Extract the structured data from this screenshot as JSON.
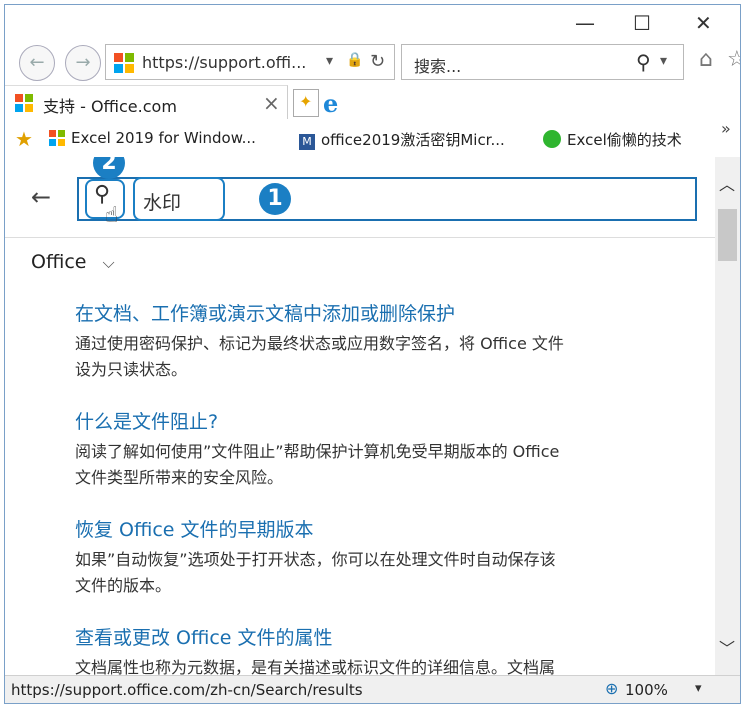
{
  "window": {
    "minimize": "—",
    "maximize": "☐",
    "close": "✕"
  },
  "nav": {
    "back": "←",
    "forward": "→",
    "address_url": "https://support.offi...",
    "address_dropdown": "▾",
    "lock": "🔒",
    "refresh": "↻",
    "search_placeholder": "搜索...",
    "search_icon": "⚲",
    "search_dropdown": "▾",
    "home": "⌂",
    "favorites": "☆",
    "tools": "⚙"
  },
  "tabs": [
    {
      "label": "支持 - Office.com",
      "close": "×"
    }
  ],
  "favorites": [
    {
      "label": "Excel 2019 for Window..."
    },
    {
      "label": "office2019激活密钥Micr..."
    },
    {
      "label": "Excel偷懒的技术"
    }
  ],
  "favorites_more": "»",
  "page": {
    "back_arrow": "←",
    "search_query": "水印",
    "category": "Office",
    "category_chevron": "⌵",
    "badges": [
      "1",
      "2"
    ],
    "results": [
      {
        "title": "在文档、工作簿或演示文稿中添加或删除保护",
        "desc_line1": "通过使用密码保护、标记为最终状态或应用数字签名，将 Office 文件",
        "desc_line2": "设为只读状态。"
      },
      {
        "title": "什么是文件阻止?",
        "desc_line1": "阅读了解如何使用”文件阻止”帮助保护计算机免受早期版本的 Office",
        "desc_line2": "文件类型所带来的安全风险。"
      },
      {
        "title": "恢复 Office 文件的早期版本",
        "desc_line1": "如果”自动恢复”选项处于打开状态，你可以在处理文件时自动保存该",
        "desc_line2": "文件的版本。"
      },
      {
        "title": "查看或更改 Office 文件的属性",
        "desc_line1": "文档属性也称为元数据，是有关描述或标识文件的详细信息。文档属",
        "desc_line2": ""
      }
    ]
  },
  "scrollbar": {
    "up": "︿",
    "down": "﹀"
  },
  "status": {
    "url": "https://support.office.com/zh-cn/Search/results",
    "zoom": "100%",
    "zoom_dropdown": "▾"
  },
  "colors": {
    "accent": "#1a6fb0",
    "badge": "#1b7fc4"
  }
}
